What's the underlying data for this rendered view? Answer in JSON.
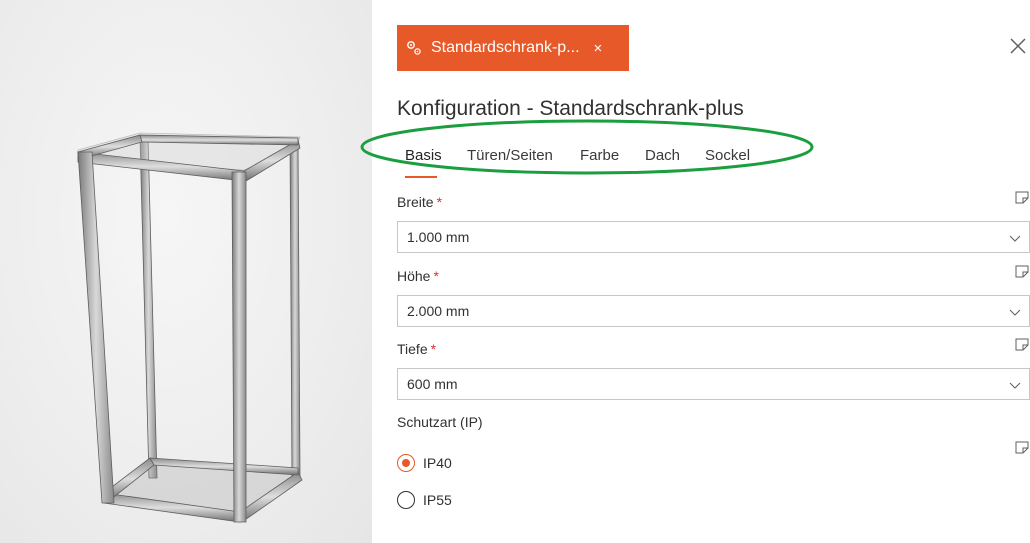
{
  "document_tab": {
    "title": "Standardschrank-p...",
    "close": "×",
    "icon": "settings-gear-icon"
  },
  "panel": {
    "title": "Konfiguration - Standardschrank-plus"
  },
  "tabs": [
    {
      "label": "Basis",
      "active": true
    },
    {
      "label": "Türen/Seiten",
      "active": false
    },
    {
      "label": "Farbe",
      "active": false
    },
    {
      "label": "Dach",
      "active": false
    },
    {
      "label": "Sockel",
      "active": false
    }
  ],
  "fields": {
    "breite": {
      "label": "Breite",
      "required_mark": "*",
      "value": "1.000 mm"
    },
    "hoehe": {
      "label": "Höhe",
      "required_mark": "*",
      "value": "2.000 mm"
    },
    "tiefe": {
      "label": "Tiefe",
      "required_mark": "*",
      "value": "600 mm"
    },
    "schutzart": {
      "label": "Schutzart (IP)",
      "options": [
        {
          "label": "IP40",
          "selected": true
        },
        {
          "label": "IP55",
          "selected": false
        }
      ]
    }
  },
  "colors": {
    "accent": "#e8592a",
    "highlight": "#1a9e3f",
    "required": "#d13438"
  }
}
